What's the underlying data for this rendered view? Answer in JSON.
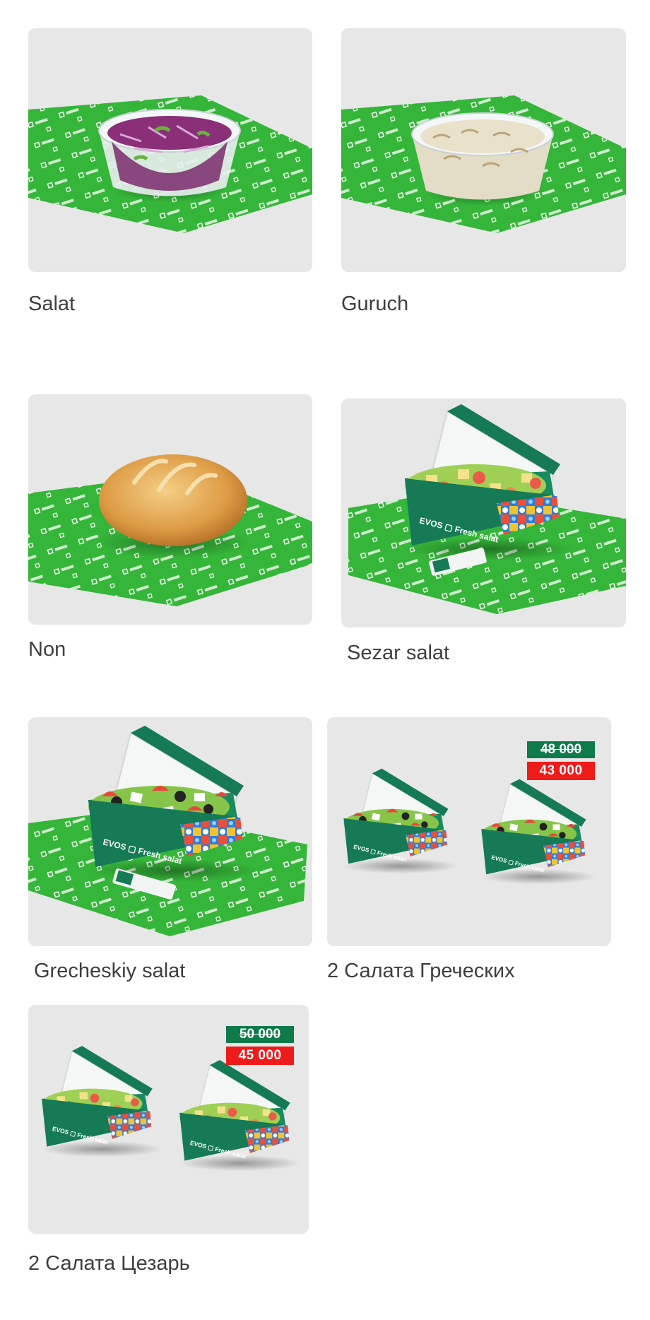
{
  "products": [
    {
      "name": "Salat"
    },
    {
      "name": "Guruch"
    },
    {
      "name": "Non"
    },
    {
      "name": "Sezar salat"
    },
    {
      "name": "Grecheskiy salat"
    },
    {
      "name": "2 Салата Греческих",
      "old_price": "48 000",
      "new_price": "43 000"
    },
    {
      "name": "2 Салата Цезарь",
      "old_price": "50 000",
      "new_price": "45 000"
    }
  ],
  "box_brand": "EVOS",
  "box_label": "Fresh salat",
  "colors": {
    "card_bg": "#e7e7e7",
    "wrap_green": "#35b539",
    "box_green": "#157a55",
    "old_price_bg": "#0f7a4a",
    "new_price_bg": "#ee1b1b"
  }
}
